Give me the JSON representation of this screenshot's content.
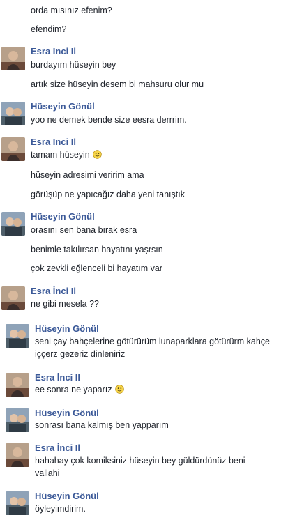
{
  "conversation": {
    "messages": [
      {
        "text": "orda mısınız efenim?"
      },
      {
        "text": "efendim?"
      },
      {
        "sender": "Esra Inci Il"
      },
      {
        "text": "burdayım hüseyin bey"
      },
      {
        "text": "artık size hüseyin desem bi mahsuru olur mu"
      },
      {
        "sender": "Hüseyin Gönül"
      },
      {
        "text": "yoo ne demek bende size eesra derrrim."
      },
      {
        "sender": "Esra Inci Il"
      },
      {
        "text": "tamam hüseyin",
        "emoji": "smiley-icon"
      },
      {
        "text": "hüseyin adresimi veririm ama"
      },
      {
        "text": "görüşüp ne yapıcağız daha yeni tanıştık"
      },
      {
        "sender": "Hüseyin Gönül"
      },
      {
        "text": "orasını sen bana bırak esra"
      },
      {
        "text": "benimle takılırsan hayatını yaşrsın"
      },
      {
        "text": "çok zevkli eğlenceli bi hayatım var"
      },
      {
        "sender": "Esra İnci Il"
      },
      {
        "text": "ne gibi mesela ??"
      },
      {
        "sender": "Hüseyin Gönül"
      },
      {
        "text": "seni çay bahçelerine götürürüm lunaparklara götürürm kahçe iççerz gezeriz dinleniriz"
      },
      {
        "sender": "Esra İnci Il"
      },
      {
        "text": "ee sonra ne yaparız",
        "emoji": "smiley-icon"
      },
      {
        "sender": "Hüseyin Gönül"
      },
      {
        "text": "sonrası bana kalmış ben yapparım"
      },
      {
        "sender": "Esra İnci Il"
      },
      {
        "text": "hahahay çok komiksiniz hüseyin bey güldürdünüz beni vallahi"
      },
      {
        "sender": "Hüseyin Gönül"
      },
      {
        "text": "öyleyimdirim."
      }
    ]
  },
  "colors": {
    "sender_name": "#3b5998",
    "message_text": "#1d2129",
    "smiley": "#f7d54a"
  }
}
